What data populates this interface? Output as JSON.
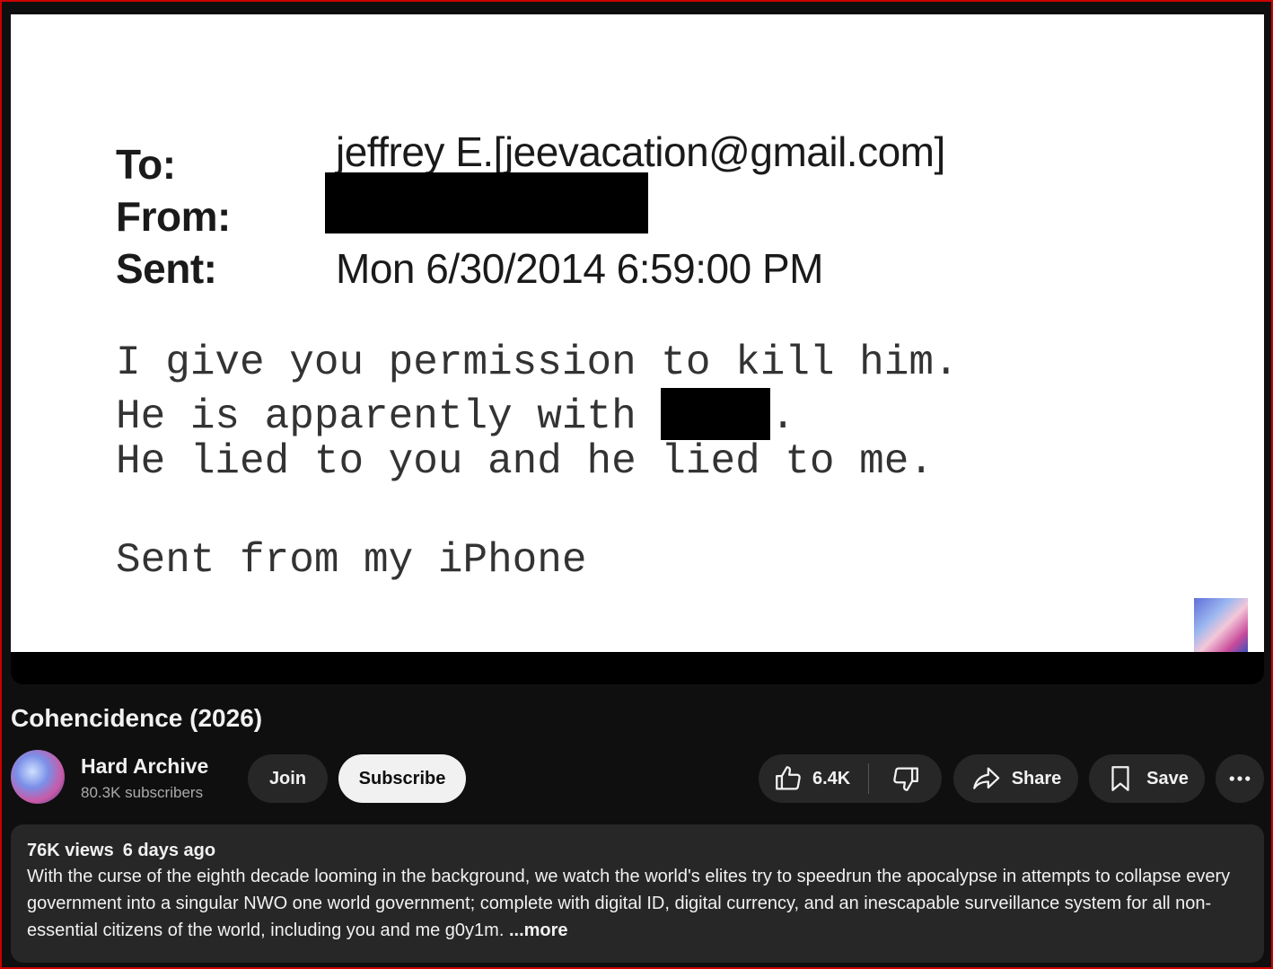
{
  "video": {
    "email": {
      "to_label": "To:",
      "to_value": "jeffrey E.[jeevacation@gmail.com]",
      "from_label": "From:",
      "sent_label": "Sent:",
      "sent_value": "Mon 6/30/2014 6:59:00 PM",
      "line1": "I give you permission to kill him.",
      "line2_pre": "He is apparently with ",
      "line2_post": ".",
      "line3": "He lied to you and he lied to me.",
      "line4": "Sent from my iPhone"
    }
  },
  "title": "Cohencidence (2026)",
  "channel": {
    "name": "Hard Archive",
    "subscribers": "80.3K subscribers"
  },
  "actions": {
    "join": "Join",
    "subscribe": "Subscribe",
    "likes": "6.4K",
    "share": "Share",
    "save": "Save"
  },
  "description": {
    "views": "76K views",
    "date": "6 days ago",
    "text": "With the curse of the eighth decade looming in the background, we watch the world's elites try to speedrun the apocalypse in attempts to collapse every government into a singular NWO one world government; complete with digital ID, digital currency, and an inescapable surveillance system for all non-essential citizens of the world, including you and me g0y1m. ",
    "more": "...more"
  },
  "icons": {
    "like": "thumbs-up-icon",
    "dislike": "thumbs-down-icon",
    "share": "share-arrow-icon",
    "save": "bookmark-icon",
    "more": "more-horizontal-icon"
  }
}
